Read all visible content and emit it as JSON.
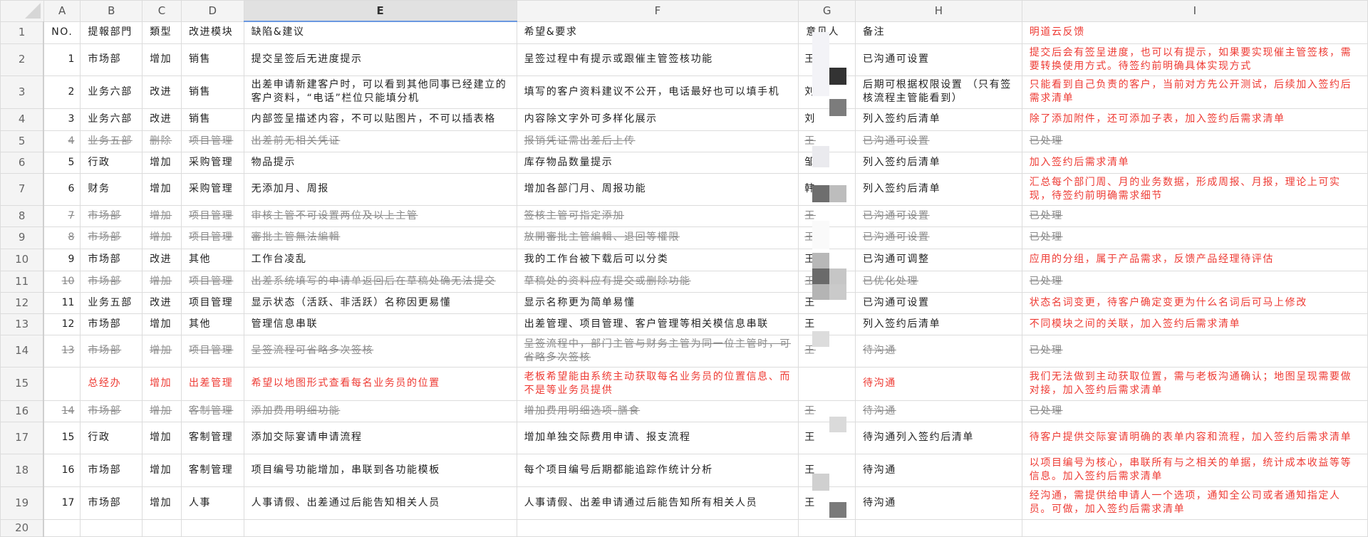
{
  "columns": [
    "A",
    "B",
    "C",
    "D",
    "E",
    "F",
    "G",
    "H",
    "I"
  ],
  "selected_column": "E",
  "header": {
    "no": "NO.",
    "dept": "提報部門",
    "type": "類型",
    "module": "改进模块",
    "defect": "缺陷&建议",
    "request": "希望&要求",
    "person": "意见人",
    "note": "备注",
    "feedback": "明道云反馈"
  },
  "rows": [
    {
      "no": "1",
      "dept": "市场部",
      "type": "增加",
      "module": "销售",
      "defect": "提交呈签后无进度提示",
      "request": "呈签过程中有提示或跟催主管签核功能",
      "person": "王",
      "note": "已沟通可设置",
      "feedback": "提交后会有签呈进度，也可以有提示，如果要实现催主管签核，需要转换使用方式。待签约前明确具体实现方式",
      "status": "normal"
    },
    {
      "no": "2",
      "dept": "业务六部",
      "type": "改进",
      "module": "销售",
      "defect": "出差申请新建客户时，可以看到其他同事已经建立的客户资料，“电话”栏位只能填分机",
      "request": "填写的客户资料建议不公开，电话最好也可以填手机",
      "person": "刘",
      "note": "后期可根据权限设置 （只有签核流程主管能看到）",
      "feedback": "只能看到自己负责的客户，当前对方先公开测试，后续加入签约后需求清单",
      "status": "normal"
    },
    {
      "no": "3",
      "dept": "业务六部",
      "type": "改进",
      "module": "销售",
      "defect": "内部签呈描述内容，不可以贴图片，不可以插表格",
      "request": "内容除文字外可多样化展示",
      "person": "刘",
      "note": "列入签约后清单",
      "feedback": "除了添加附件，还可添加子表，加入签约后需求清单",
      "status": "normal"
    },
    {
      "no": "4",
      "dept": "业务五部",
      "type": "删除",
      "module": "项目管理",
      "defect": "出差前无相关凭证",
      "request": "报销凭证需出差后上传",
      "person": "王",
      "note": "已沟通可设置",
      "feedback": "已处理",
      "status": "struck"
    },
    {
      "no": "5",
      "dept": "行政",
      "type": "增加",
      "module": "采购管理",
      "defect": "物品提示",
      "request": "库存物品数量提示",
      "person": "邹",
      "note": "列入签约后清单",
      "feedback": "加入签约后需求清单",
      "status": "normal"
    },
    {
      "no": "6",
      "dept": "财务",
      "type": "增加",
      "module": "采购管理",
      "defect": "无添加月、周报",
      "request": "增加各部门月、周报功能",
      "person": "韩",
      "note": "列入签约后清单",
      "feedback": "汇总每个部门周、月的业务数据，形成周报、月报，理论上可实现，待签约前明确需求细节",
      "status": "normal"
    },
    {
      "no": "7",
      "dept": "市场部",
      "type": "增加",
      "module": "项目管理",
      "defect": "审核主管不可设置两位及以上主管",
      "request": "签核主管可指定添加",
      "person": "王",
      "note": "已沟通可设置",
      "feedback": "已处理",
      "status": "struck"
    },
    {
      "no": "8",
      "dept": "市场部",
      "type": "增加",
      "module": "项目管理",
      "defect": "審批主管無法編輯",
      "request": "放開審批主管編輯、退回等權限",
      "person": "王",
      "note": "已沟通可设置",
      "feedback": "已处理",
      "status": "struck"
    },
    {
      "no": "9",
      "dept": "市场部",
      "type": "改进",
      "module": "其他",
      "defect": "工作台凌乱",
      "request": "我的工作台被下载后可以分类",
      "person": "王",
      "note": "已沟通可调整",
      "feedback": "应用的分组，属于产品需求，反馈产品经理待评估",
      "status": "normal"
    },
    {
      "no": "10",
      "dept": "市场部",
      "type": "增加",
      "module": "项目管理",
      "defect": "出差系统填写的申请单返回后在草稿处确无法提交",
      "request": "草稿处的资料应有提交或删除功能",
      "person": "王",
      "note": "已优化处理",
      "feedback": "已处理",
      "status": "struck"
    },
    {
      "no": "11",
      "dept": "业务五部",
      "type": "改进",
      "module": "项目管理",
      "defect": "显示状态（活跃、非活跃）名称因更易懂",
      "request": "显示名称更为简单易懂",
      "person": "王",
      "note": "已沟通可设置",
      "feedback": "状态名词变更，待客户确定变更为什么名词后可马上修改",
      "status": "normal"
    },
    {
      "no": "12",
      "dept": "市场部",
      "type": "增加",
      "module": "其他",
      "defect": "管理信息串联",
      "request": "出差管理、项目管理、客户管理等相关模信息串联",
      "person": "王",
      "note": "列入签约后清单",
      "feedback": "不同模块之间的关联，加入签约后需求清单",
      "status": "normal"
    },
    {
      "no": "13",
      "dept": "市场部",
      "type": "增加",
      "module": "项目管理",
      "defect": "呈签流程可省略多次签核",
      "request": "呈签流程中，部门主管与财务主管为同一位主管时，可省略多次签核",
      "person": "王",
      "note": "待沟通",
      "feedback": "已处理",
      "status": "struck"
    },
    {
      "no": "",
      "dept": "总经办",
      "type": "增加",
      "module": "出差管理",
      "defect": "希望以地图形式查看每名业务员的位置",
      "request": "老板希望能由系统主动获取每名业务员的位置信息、而不是等业务员提供",
      "person": "",
      "note": "待沟通",
      "feedback": "我们无法做到主动获取位置，需与老板沟通确认；地图呈现需要做对接，加入签约后需求清单",
      "status": "red"
    },
    {
      "no": "14",
      "dept": "市场部",
      "type": "增加",
      "module": "客制管理",
      "defect": "添加费用明细功能",
      "request": "增加费用明细选项-膳食",
      "person": "王",
      "note": "待沟通",
      "feedback": "已处理",
      "status": "struck"
    },
    {
      "no": "15",
      "dept": "行政",
      "type": "增加",
      "module": "客制管理",
      "defect": "添加交际宴请申请流程",
      "request": "增加单独交际费用申请、报支流程",
      "person": "王",
      "note": "待沟通列入签约后清单",
      "feedback": "待客户提供交际宴请明确的表单内容和流程，加入签约后需求清单",
      "status": "normal"
    },
    {
      "no": "16",
      "dept": "市场部",
      "type": "增加",
      "module": "客制管理",
      "defect": "项目编号功能增加，串联到各功能模板",
      "request": "每个项目编号后期都能追踪作统计分析",
      "person": "王",
      "note": "待沟通",
      "feedback": "以项目编号为核心，串联所有与之相关的单据，统计成本收益等等信息。加入签约后需求清单",
      "status": "normal"
    },
    {
      "no": "17",
      "dept": "市场部",
      "type": "增加",
      "module": "人事",
      "defect": "人事请假、出差通过后能告知相关人员",
      "request": "人事请假、出差申请通过后能告知所有相关人员",
      "person": "王",
      "note": "待沟通",
      "feedback": "经沟通，需提供给申请人一个选项，通知全公司或者通知指定人员。可做，加入签约后需求清单",
      "status": "normal"
    }
  ],
  "empty_row_number": "20",
  "colors": {
    "red": "#ee3a33",
    "struck": "#8a8a8a",
    "selected_header": "#e1e1e1",
    "selection_line": "#6a98e0"
  }
}
